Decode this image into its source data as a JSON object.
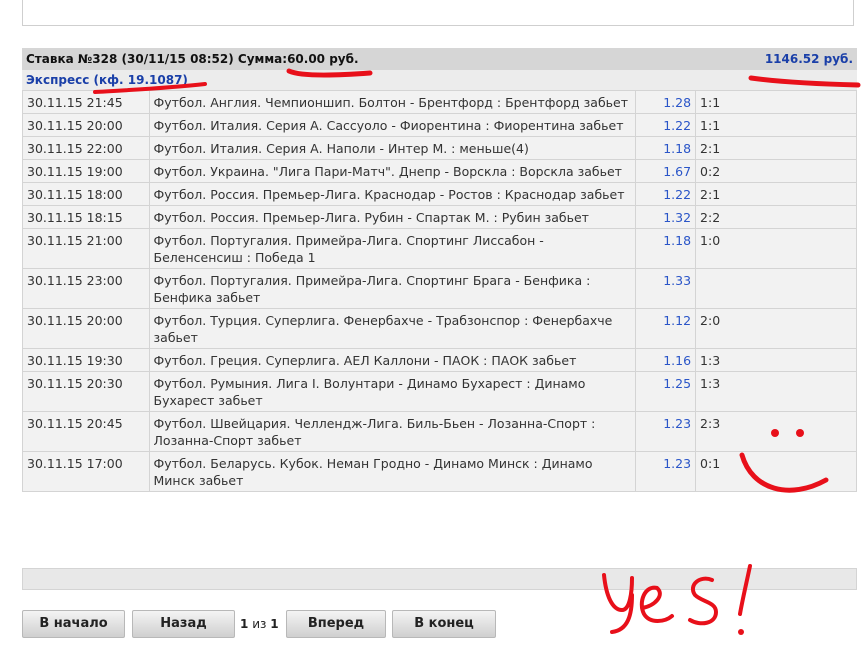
{
  "bet": {
    "title": "Ставка №328  (30/11/15 08:52) Сумма:60.00 руб.",
    "payout": "1146.52 руб.",
    "express_label": "Экспресс (кф. 19.1087)"
  },
  "events": [
    {
      "date": "30.11.15 21:45",
      "event": "Футбол. Англия. Чемпионшип. Болтон - Брентфорд : Брентфорд забьет",
      "odds": "1.28",
      "score": "1:1"
    },
    {
      "date": "30.11.15 20:00",
      "event": "Футбол. Италия. Серия А. Сассуоло - Фиорентина : Фиорентина забьет",
      "odds": "1.22",
      "score": "1:1"
    },
    {
      "date": "30.11.15 22:00",
      "event": "Футбол. Италия. Серия А. Наполи - Интер М. : меньше(4)",
      "odds": "1.18",
      "score": "2:1"
    },
    {
      "date": "30.11.15 19:00",
      "event": "Футбол. Украина. \"Лига Пари-Матч\". Днепр - Ворскла : Ворскла забьет",
      "odds": "1.67",
      "score": "0:2"
    },
    {
      "date": "30.11.15 18:00",
      "event": "Футбол. Россия. Премьер-Лига. Краснодар - Ростов : Краснодар забьет",
      "odds": "1.22",
      "score": "2:1"
    },
    {
      "date": "30.11.15 18:15",
      "event": "Футбол. Россия. Премьер-Лига. Рубин - Спартак М. : Рубин забьет",
      "odds": "1.32",
      "score": "2:2"
    },
    {
      "date": "30.11.15 21:00",
      "event": "Футбол. Португалия. Примейра-Лига. Спортинг Лиссабон - Беленсенсиш : Победа 1",
      "odds": "1.18",
      "score": "1:0"
    },
    {
      "date": "30.11.15 23:00",
      "event": "Футбол. Португалия. Примейра-Лига. Спортинг Брага - Бенфика : Бенфика забьет",
      "odds": "1.33",
      "score": ""
    },
    {
      "date": "30.11.15 20:00",
      "event": "Футбол. Турция. Суперлига. Фенербахче - Трабзонспор : Фенербахче забьет",
      "odds": "1.12",
      "score": "2:0"
    },
    {
      "date": "30.11.15 19:30",
      "event": "Футбол. Греция. Суперлига. АЕЛ Каллони - ПАОК : ПАОК забьет",
      "odds": "1.16",
      "score": "1:3"
    },
    {
      "date": "30.11.15 20:30",
      "event": "Футбол. Румыния. Лига I. Волунтари - Динамо Бухарест : Динамо Бухарест забьет",
      "odds": "1.25",
      "score": "1:3"
    },
    {
      "date": "30.11.15 20:45",
      "event": "Футбол. Швейцария. Челлендж-Лига. Биль-Бьен - Лозанна-Спорт : Лозанна-Спорт забьет",
      "odds": "1.23",
      "score": "2:3"
    },
    {
      "date": "30.11.15 17:00",
      "event": "Футбол. Беларусь. Кубок. Неман Гродно - Динамо Минск : Динамо Минск забьет",
      "odds": "1.23",
      "score": "0:1"
    }
  ],
  "pagination": {
    "first_label": "В начало",
    "prev_label": "Назад",
    "current_page": "1",
    "of_label": "из",
    "total_pages": "1",
    "next_label": "Вперед",
    "last_label": "В конец"
  },
  "annotations": {
    "handwritten_text": "Yes!",
    "ink_color": "#e8101a"
  }
}
